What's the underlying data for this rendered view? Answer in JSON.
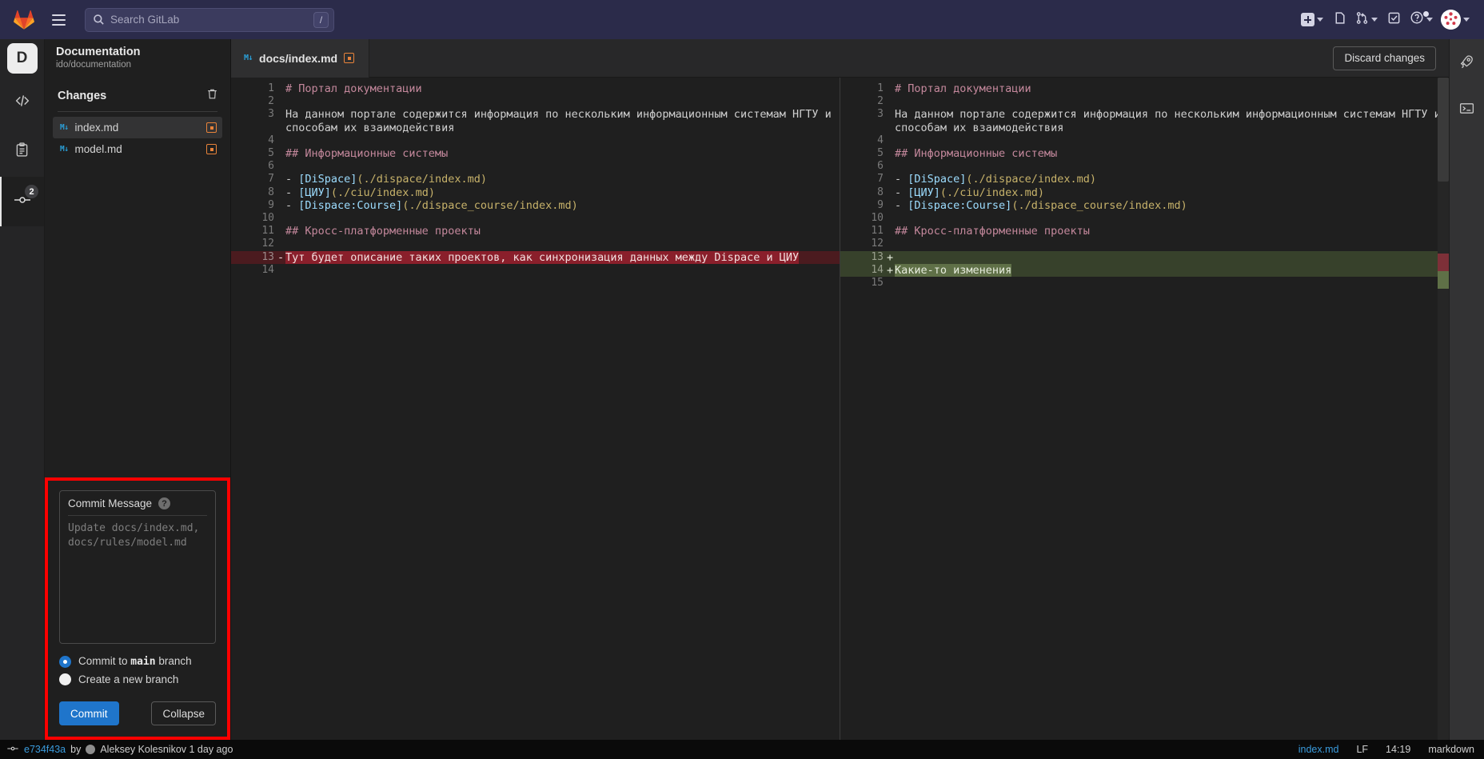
{
  "topbar": {
    "logo": "gitlab-logo",
    "menu_icon": "hamburger-icon",
    "search": {
      "placeholder": "Search GitLab",
      "value": "",
      "shortcut": "/"
    },
    "actions": [
      {
        "name": "create-new-menu",
        "icon": "plus-square-icon",
        "has_caret": true
      },
      {
        "name": "merge-requests-link",
        "icon": "merge-request-icon",
        "has_caret": false
      },
      {
        "name": "branch-menu",
        "icon": "branch-icon",
        "has_caret": true
      },
      {
        "name": "todos-link",
        "icon": "todo-check-icon",
        "has_caret": false
      },
      {
        "name": "help-menu",
        "icon": "help-circle-icon",
        "has_caret": true,
        "has_dot": true
      },
      {
        "name": "user-menu",
        "icon": "avatar",
        "has_caret": true
      }
    ]
  },
  "rail": {
    "project_initial": "D",
    "items": [
      {
        "name": "edit",
        "icon": "code-brackets-icon",
        "badge": ""
      },
      {
        "name": "review",
        "icon": "clipboard-icon",
        "badge": ""
      },
      {
        "name": "commit",
        "icon": "commit-icon",
        "badge": "2"
      }
    ]
  },
  "sidebar": {
    "project_name": "Documentation",
    "project_path": "ido/documentation",
    "changes_title": "Changes",
    "discard_all_icon": "trash-icon",
    "files": [
      {
        "name": "index.md",
        "icon": "markdown-icon",
        "status": "modified",
        "selected": true
      },
      {
        "name": "model.md",
        "icon": "markdown-icon",
        "status": "modified",
        "selected": false
      }
    ]
  },
  "commit_panel": {
    "label": "Commit Message",
    "help_icon": "help-circle-icon",
    "message_value": "",
    "message_placeholder": "Update docs/index.md, docs/rules/model.md",
    "options": [
      {
        "label_prefix": "Commit to ",
        "label_strong": "main",
        "label_suffix": " branch",
        "selected": true
      },
      {
        "label_prefix": "Create a new branch",
        "label_strong": "",
        "label_suffix": "",
        "selected": false
      }
    ],
    "commit_button": "Commit",
    "collapse_button": "Collapse",
    "highlight_color": "#fe0000"
  },
  "editor": {
    "tab": {
      "label": "docs/index.md",
      "icon": "markdown-icon",
      "status": "modified"
    },
    "discard_button": "Discard changes"
  },
  "diff": {
    "left": [
      {
        "num": "1",
        "sign": "",
        "type": "ctx",
        "tokens": [
          {
            "t": "# Портал документации",
            "c": "c-head"
          }
        ]
      },
      {
        "num": "2",
        "sign": "",
        "type": "ctx",
        "tokens": []
      },
      {
        "num": "3",
        "sign": "",
        "type": "ctx",
        "tokens": [
          {
            "t": "На данном портале содержится информация по нескольким информационным системам НГТУ и способам их взаимодействия",
            "c": "c-plain"
          }
        ]
      },
      {
        "num": "4",
        "sign": "",
        "type": "ctx",
        "tokens": []
      },
      {
        "num": "5",
        "sign": "",
        "type": "ctx",
        "tokens": [
          {
            "t": "## Информационные системы",
            "c": "c-head"
          }
        ]
      },
      {
        "num": "6",
        "sign": "",
        "type": "ctx",
        "tokens": []
      },
      {
        "num": "7",
        "sign": "",
        "type": "ctx",
        "tokens": [
          {
            "t": "- ",
            "c": "c-dash"
          },
          {
            "t": "[DiSpace]",
            "c": "c-bracket"
          },
          {
            "t": "(./dispace/index.md)",
            "c": "c-link"
          }
        ]
      },
      {
        "num": "8",
        "sign": "",
        "type": "ctx",
        "tokens": [
          {
            "t": "- ",
            "c": "c-dash"
          },
          {
            "t": "[ЦИУ]",
            "c": "c-bracket"
          },
          {
            "t": "(./ciu/index.md)",
            "c": "c-link"
          }
        ]
      },
      {
        "num": "9",
        "sign": "",
        "type": "ctx",
        "tokens": [
          {
            "t": "- ",
            "c": "c-dash"
          },
          {
            "t": "[Dispace:Course]",
            "c": "c-bracket"
          },
          {
            "t": "(./dispace_course/index.md)",
            "c": "c-link"
          }
        ]
      },
      {
        "num": "10",
        "sign": "",
        "type": "ctx",
        "tokens": []
      },
      {
        "num": "11",
        "sign": "",
        "type": "ctx",
        "tokens": [
          {
            "t": "## Кросс-платформенные проекты",
            "c": "c-head"
          }
        ]
      },
      {
        "num": "12",
        "sign": "",
        "type": "ctx",
        "tokens": []
      },
      {
        "num": "13",
        "sign": "-",
        "type": "del",
        "tokens": [
          {
            "t": "Тут будет описание таких проектов, как синхронизация данных между Dispace и ЦИУ",
            "c": "wh-del"
          }
        ]
      },
      {
        "num": "14",
        "sign": "",
        "type": "ctx",
        "tokens": []
      }
    ],
    "right": [
      {
        "num": "1",
        "sign": "",
        "type": "ctx",
        "tokens": [
          {
            "t": "# Портал документации",
            "c": "c-head"
          }
        ]
      },
      {
        "num": "2",
        "sign": "",
        "type": "ctx",
        "tokens": []
      },
      {
        "num": "3",
        "sign": "",
        "type": "ctx",
        "tokens": [
          {
            "t": "На данном портале содержится информация по нескольким информационным системам НГТУ и способам их взаимодействия",
            "c": "c-plain"
          }
        ]
      },
      {
        "num": "4",
        "sign": "",
        "type": "ctx",
        "tokens": []
      },
      {
        "num": "5",
        "sign": "",
        "type": "ctx",
        "tokens": [
          {
            "t": "## Информационные системы",
            "c": "c-head"
          }
        ]
      },
      {
        "num": "6",
        "sign": "",
        "type": "ctx",
        "tokens": []
      },
      {
        "num": "7",
        "sign": "",
        "type": "ctx",
        "tokens": [
          {
            "t": "- ",
            "c": "c-dash"
          },
          {
            "t": "[DiSpace]",
            "c": "c-bracket"
          },
          {
            "t": "(./dispace/index.md)",
            "c": "c-link"
          }
        ]
      },
      {
        "num": "8",
        "sign": "",
        "type": "ctx",
        "tokens": [
          {
            "t": "- ",
            "c": "c-dash"
          },
          {
            "t": "[ЦИУ]",
            "c": "c-bracket"
          },
          {
            "t": "(./ciu/index.md)",
            "c": "c-link"
          }
        ]
      },
      {
        "num": "9",
        "sign": "",
        "type": "ctx",
        "tokens": [
          {
            "t": "- ",
            "c": "c-dash"
          },
          {
            "t": "[Dispace:Course]",
            "c": "c-bracket"
          },
          {
            "t": "(./dispace_course/index.md)",
            "c": "c-link"
          }
        ]
      },
      {
        "num": "10",
        "sign": "",
        "type": "ctx",
        "tokens": []
      },
      {
        "num": "11",
        "sign": "",
        "type": "ctx",
        "tokens": [
          {
            "t": "## Кросс-платформенные проекты",
            "c": "c-head"
          }
        ]
      },
      {
        "num": "12",
        "sign": "",
        "type": "ctx",
        "tokens": []
      },
      {
        "num": "13",
        "sign": "+",
        "type": "ins",
        "tokens": []
      },
      {
        "num": "14",
        "sign": "+",
        "type": "ins",
        "tokens": [
          {
            "t": "Какие-то изменения",
            "c": "wh-ins"
          }
        ]
      },
      {
        "num": "15",
        "sign": "",
        "type": "ctx",
        "tokens": []
      }
    ]
  },
  "right_rail": [
    {
      "name": "pipelines",
      "icon": "rocket-icon"
    },
    {
      "name": "terminal",
      "icon": "terminal-icon"
    }
  ],
  "statusbar": {
    "commit_icon": "commit-icon",
    "commit_sha": "e734f43a",
    "by_label": "by",
    "author": "Aleksey Kolesnikov 1 day ago",
    "file": "index.md",
    "eol": "LF",
    "time": "14:19",
    "language": "markdown"
  }
}
